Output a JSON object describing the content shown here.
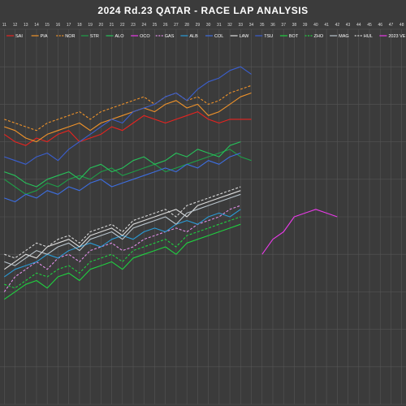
{
  "chart_data": {
    "type": "line",
    "title": "2024 Rd.23 QATAR  - RACE LAP ANALYSIS",
    "x": [
      11,
      12,
      13,
      14,
      15,
      16,
      17,
      18,
      19,
      20,
      21,
      22,
      23,
      24,
      25,
      26,
      27,
      28,
      29,
      30,
      31,
      32,
      33,
      34,
      35,
      36,
      37,
      38,
      39,
      40,
      41,
      42,
      43,
      44,
      45,
      46,
      47,
      48
    ],
    "x_tick_labels": [
      "11",
      "12",
      "13",
      "14",
      "15",
      "16",
      "17",
      "18",
      "19",
      "20",
      "21",
      "22",
      "23",
      "24",
      "25",
      "26",
      "27",
      "28",
      "29",
      "30",
      "31",
      "32",
      "33",
      "34",
      "35",
      "36",
      "37",
      "38",
      "39",
      "40",
      "41",
      "42",
      "43",
      "44",
      "45",
      "46",
      "47",
      "48"
    ],
    "xlim": [
      10.6,
      48.4
    ],
    "ylim": [
      0,
      100
    ],
    "grid": true,
    "legend_position": "top",
    "background": "#3b3b3b",
    "grid_color": "#555555",
    "series": [
      {
        "name": "SAI",
        "color": "#e8231f",
        "dash": "solid",
        "values": [
          72,
          70,
          69,
          71,
          70,
          72,
          73,
          70,
          71,
          72,
          74,
          73,
          75,
          77,
          76,
          75,
          76,
          77,
          78,
          76,
          75,
          76,
          76,
          76,
          null,
          null,
          null,
          null,
          null,
          null,
          null,
          null,
          null,
          null,
          null,
          null,
          null,
          null
        ]
      },
      {
        "name": "PIA",
        "color": "#f0932a",
        "dash": "solid",
        "values": [
          74,
          73,
          71,
          70,
          72,
          73,
          74,
          75,
          73,
          75,
          76,
          77,
          78,
          79,
          78,
          80,
          81,
          79,
          80,
          77,
          78,
          80,
          82,
          83,
          null,
          null,
          null,
          null,
          null,
          null,
          null,
          null,
          null,
          null,
          null,
          null,
          null,
          null
        ]
      },
      {
        "name": "NOR",
        "color": "#f0932a",
        "dash": "dashed",
        "values": [
          76,
          75,
          74,
          73,
          75,
          76,
          77,
          78,
          76,
          78,
          79,
          80,
          81,
          82,
          80,
          82,
          83,
          81,
          82,
          80,
          81,
          83,
          84,
          85,
          null,
          null,
          null,
          null,
          null,
          null,
          null,
          null,
          null,
          null,
          null,
          null,
          null,
          null
        ]
      },
      {
        "name": "STR",
        "color": "#1e9e48",
        "dash": "solid",
        "values": [
          60,
          58,
          56,
          57,
          59,
          58,
          60,
          61,
          60,
          62,
          63,
          61,
          62,
          63,
          64,
          62,
          63,
          64,
          65,
          66,
          67,
          68,
          66,
          65,
          null,
          null,
          null,
          null,
          null,
          null,
          null,
          null,
          null,
          null,
          null,
          null,
          null,
          null
        ]
      },
      {
        "name": "ALO",
        "color": "#27c25a",
        "dash": "solid",
        "values": [
          62,
          61,
          59,
          58,
          60,
          61,
          62,
          60,
          63,
          64,
          62,
          63,
          65,
          66,
          64,
          65,
          67,
          66,
          68,
          67,
          66,
          69,
          70,
          null,
          null,
          null,
          null,
          null,
          null,
          null,
          null,
          null,
          null,
          null,
          null,
          null,
          null,
          null
        ]
      },
      {
        "name": "OCO",
        "color": "#e93ae8",
        "dash": "solid",
        "values": [
          null,
          null,
          null,
          null,
          null,
          null,
          null,
          null,
          null,
          null,
          null,
          null,
          null,
          null,
          null,
          null,
          null,
          null,
          null,
          null,
          null,
          null,
          null,
          null,
          40,
          44,
          46,
          50,
          51,
          52,
          51,
          50,
          null,
          null,
          null,
          null,
          null,
          null
        ]
      },
      {
        "name": "GAS",
        "color": "#e08ee6",
        "dash": "dashed",
        "values": [
          30,
          34,
          36,
          38,
          36,
          39,
          40,
          38,
          41,
          42,
          43,
          41,
          42,
          44,
          45,
          46,
          47,
          46,
          48,
          49,
          50,
          52,
          53,
          null,
          null,
          null,
          null,
          null,
          null,
          null,
          null,
          null,
          null,
          null,
          null,
          null,
          null,
          null
        ]
      },
      {
        "name": "ALB",
        "color": "#2a9bd6",
        "dash": "solid",
        "values": [
          34,
          36,
          37,
          38,
          40,
          39,
          41,
          42,
          43,
          42,
          44,
          45,
          44,
          46,
          47,
          46,
          48,
          49,
          48,
          50,
          51,
          50,
          52,
          null,
          null,
          null,
          null,
          null,
          null,
          null,
          null,
          null,
          null,
          null,
          null,
          null,
          null,
          null
        ]
      },
      {
        "name": "COL",
        "color": "#3d6ee0",
        "dash": "solid",
        "values": [
          55,
          54,
          56,
          55,
          57,
          56,
          58,
          57,
          59,
          60,
          58,
          59,
          60,
          61,
          62,
          63,
          62,
          64,
          63,
          65,
          64,
          66,
          67,
          null,
          null,
          null,
          null,
          null,
          null,
          null,
          null,
          null,
          null,
          null,
          null,
          null,
          null,
          null
        ]
      },
      {
        "name": "LAW",
        "color": "#dddddd",
        "dash": "solid",
        "values": [
          36,
          38,
          40,
          39,
          42,
          43,
          44,
          42,
          45,
          46,
          47,
          45,
          48,
          49,
          50,
          51,
          52,
          50,
          53,
          54,
          55,
          56,
          57,
          null,
          null,
          null,
          null,
          null,
          null,
          null,
          null,
          null,
          null,
          null,
          null,
          null,
          null,
          null
        ]
      },
      {
        "name": "TSU",
        "color": "#3a5fd0",
        "dash": "solid",
        "values": [
          66,
          65,
          64,
          66,
          67,
          65,
          68,
          70,
          72,
          74,
          76,
          75,
          78,
          79,
          80,
          82,
          83,
          81,
          84,
          86,
          87,
          89,
          90,
          88,
          null,
          null,
          null,
          null,
          null,
          null,
          null,
          null,
          null,
          null,
          null,
          null,
          null,
          null
        ]
      },
      {
        "name": "BOT",
        "color": "#20d040",
        "dash": "solid",
        "values": [
          28,
          30,
          32,
          33,
          31,
          34,
          35,
          33,
          36,
          37,
          38,
          36,
          39,
          40,
          41,
          42,
          40,
          43,
          44,
          45,
          46,
          47,
          48,
          null,
          null,
          null,
          null,
          null,
          null,
          null,
          null,
          null,
          null,
          null,
          null,
          null,
          null,
          null
        ]
      },
      {
        "name": "ZHO",
        "color": "#20d040",
        "dash": "dashed",
        "values": [
          32,
          31,
          33,
          35,
          34,
          36,
          37,
          35,
          38,
          39,
          40,
          38,
          41,
          42,
          43,
          44,
          42,
          45,
          46,
          47,
          48,
          49,
          50,
          null,
          null,
          null,
          null,
          null,
          null,
          null,
          null,
          null,
          null,
          null,
          null,
          null,
          null,
          null
        ]
      },
      {
        "name": "MAG",
        "color": "#b9c4cc",
        "dash": "solid",
        "values": [
          38,
          37,
          39,
          41,
          40,
          42,
          43,
          41,
          44,
          45,
          46,
          44,
          47,
          48,
          49,
          50,
          48,
          51,
          52,
          53,
          54,
          55,
          56,
          null,
          null,
          null,
          null,
          null,
          null,
          null,
          null,
          null,
          null,
          null,
          null,
          null,
          null,
          null
        ]
      },
      {
        "name": "HUL",
        "color": "#d8d8d8",
        "dash": "dashed",
        "values": [
          40,
          39,
          41,
          43,
          42,
          44,
          45,
          43,
          46,
          47,
          48,
          46,
          49,
          50,
          51,
          52,
          50,
          53,
          54,
          55,
          56,
          57,
          58,
          null,
          null,
          null,
          null,
          null,
          null,
          null,
          null,
          null,
          null,
          null,
          null,
          null,
          null,
          null
        ]
      },
      {
        "name": "2023 VE",
        "color": "#e93ae8",
        "dash": "solid",
        "values": [
          null,
          null,
          null,
          null,
          null,
          null,
          null,
          null,
          null,
          null,
          null,
          null,
          null,
          null,
          null,
          null,
          null,
          null,
          null,
          null,
          null,
          null,
          null,
          null,
          null,
          null,
          null,
          null,
          null,
          null,
          null,
          null,
          null,
          null,
          null,
          null,
          null,
          null
        ]
      }
    ]
  }
}
